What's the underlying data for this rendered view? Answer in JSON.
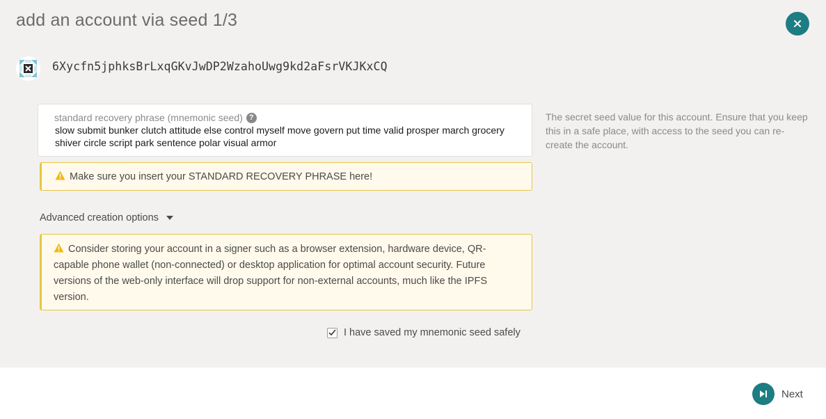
{
  "modal": {
    "title": "add an account via seed 1/3"
  },
  "account": {
    "address": "6Xycfn5jphksBrLxqGKvJwDP2WzahoUwg9kd2aFsrVKJKxCQ"
  },
  "seed": {
    "label": "standard recovery phrase (mnemonic seed)",
    "value": "slow submit bunker clutch attitude else control myself move govern put time valid prosper march grocery shiver circle script park sentence polar visual armor",
    "help": "The secret seed value for this account. Ensure that you keep this in a safe place, with access to the seed you can re-create the account."
  },
  "warnings": {
    "standard_phrase": "Make sure you insert your STANDARD RECOVERY PHRASE here!",
    "signer": "Consider storing your account in a signer such as a browser extension, hardware device, QR-capable phone wallet (non-connected) or desktop application for optimal account security. Future versions of the web-only interface will drop support for non-external accounts, much like the IPFS version."
  },
  "advanced": {
    "label": "Advanced creation options"
  },
  "confirm": {
    "label": "I have saved my mnemonic seed safely",
    "checked": true
  },
  "footer": {
    "next_label": "Next"
  },
  "colors": {
    "accent": "#1e7c83",
    "warning_border": "#e8c547",
    "warning_bg": "#fffaeb",
    "warning_icon": "#f2b90d"
  },
  "icons": {
    "close": "close-icon",
    "help": "help-icon",
    "warning": "warning-icon",
    "caret": "caret-down-icon",
    "check": "check-icon",
    "next": "skip-next-icon",
    "identicon": "account-identicon"
  }
}
